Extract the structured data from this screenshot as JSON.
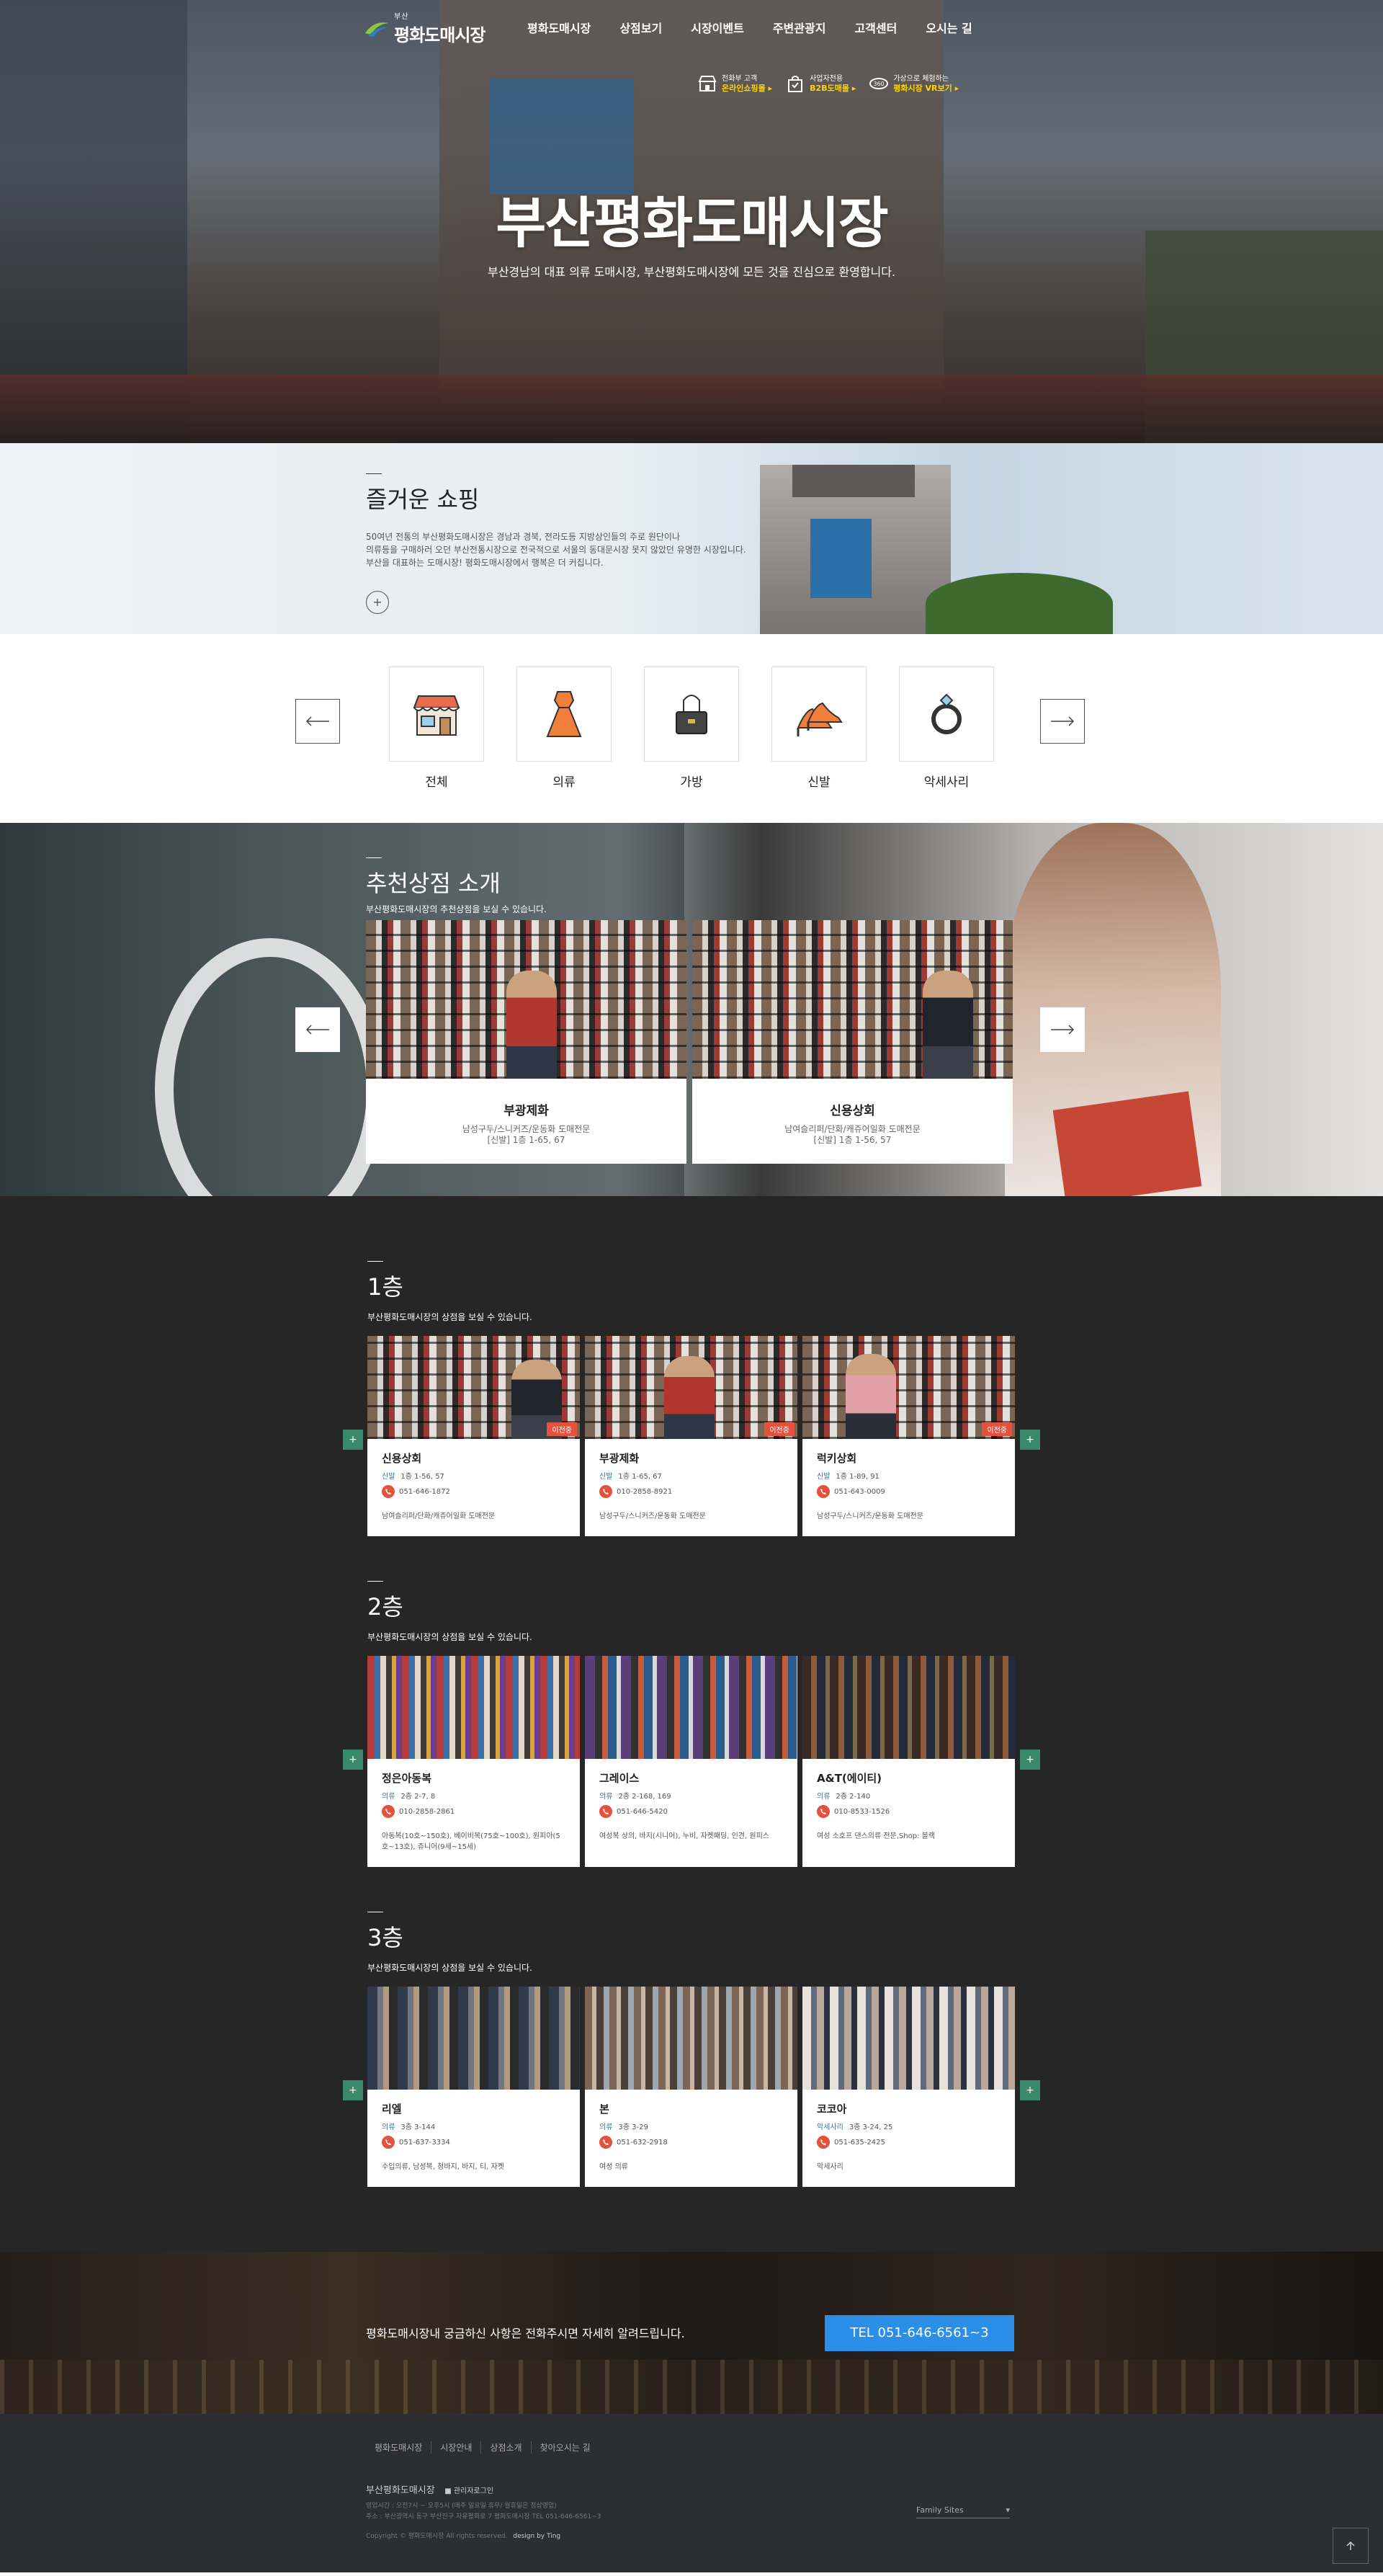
{
  "header": {
    "logo_small": "부산",
    "logo_main": "평화도매시장",
    "nav": [
      "평화도매시장",
      "상점보기",
      "시장이벤트",
      "주변관광지",
      "고객센터",
      "오시는 길"
    ],
    "quick": [
      {
        "line1": "전화부 고객",
        "line2": "온라인쇼핑몰 ▸",
        "icon": "shop-icon"
      },
      {
        "line1": "사업자전용",
        "line2": "B2B도매몰 ▸",
        "icon": "bag-icon"
      },
      {
        "line1": "가상으로 체험하는",
        "line2": "평화시장 VR보기 ▸",
        "icon": "vr-icon"
      }
    ]
  },
  "hero": {
    "title": "부산평화도매시장",
    "subtitle": "부산경남의 대표 의류 도매시장, 부산평화도매시장에 모든 것을 진심으로 환영합니다."
  },
  "shopping": {
    "title": "즐거운 쇼핑",
    "lines": [
      "50여년 전통의 부산평화도매시장은 경남과 경북, 전라도등 지방상인들의 주로 원단이나",
      "의류등을 구매하러 오던 부산전통시장으로 전국적으로 서울의 동대문시장 못지 않았던 유명한 시장입니다.",
      "부산을 대표하는 도매시장! 평화도매시장에서 행복은 더 커집니다."
    ],
    "more": "+"
  },
  "categories": {
    "items": [
      {
        "label": "전체",
        "icon": "store-icon"
      },
      {
        "label": "의류",
        "icon": "dress-icon"
      },
      {
        "label": "가방",
        "icon": "handbag-icon"
      },
      {
        "label": "신발",
        "icon": "heels-icon"
      },
      {
        "label": "악세사리",
        "icon": "ring-icon"
      }
    ]
  },
  "recommended": {
    "title": "추천상점 소개",
    "subtitle": "부산평화도매시장의 추천상점을 보실 수 있습니다.",
    "cards": [
      {
        "name": "부광제화",
        "desc1": "남성구두/스니커즈/운동화 도매전문",
        "desc2": "[신발] 1층 1-65, 67"
      },
      {
        "name": "신용상회",
        "desc1": "남여슬리퍼/단화/캐쥬어일화 도매전문",
        "desc2": "[신발] 1층 1-56, 57"
      }
    ]
  },
  "floors": [
    {
      "title": "1층",
      "subtitle": "부산평화도매시장의 상점을 보실 수 있습니다.",
      "cards": [
        {
          "name": "신용상회",
          "cat": "신발",
          "loc": "1층 1-56, 57",
          "tel": "051-646-1872",
          "note": "남여슬리퍼/단화/캐쥬어일화 도매전문",
          "badge": "이전중"
        },
        {
          "name": "부광제화",
          "cat": "신발",
          "loc": "1층 1-65, 67",
          "tel": "010-2858-8921",
          "note": "남성구두/스니커즈/운동화 도매전문",
          "badge": "이전중"
        },
        {
          "name": "럭키상회",
          "cat": "신발",
          "loc": "1층 1-89, 91",
          "tel": "051-643-0009",
          "note": "남성구두/스니커즈/운동화 도매전문",
          "badge": "이전중"
        }
      ]
    },
    {
      "title": "2층",
      "subtitle": "부산평화도매시장의 상점을 보실 수 있습니다.",
      "cards": [
        {
          "name": "정은아동복",
          "cat": "의류",
          "loc": "2층 2-7, 8",
          "tel": "010-2858-2861",
          "note": "아동복(10호~150호), 베이비복(75호~100호), 원피아(5호~13호), 쥬니어(9세~15세)",
          "badge": ""
        },
        {
          "name": "그레이스",
          "cat": "의류",
          "loc": "2층 2-168, 169",
          "tel": "051-646-5420",
          "note": "여성복 상의, 바지(시니어), 누비, 자켓패딩, 인견, 원피스",
          "badge": ""
        },
        {
          "name": "A&T(에이티)",
          "cat": "의류",
          "loc": "2층 2-140",
          "tel": "010-8533-1526",
          "note": "여성 소호프 댄스의류 전문,Shop: 블랙",
          "badge": ""
        }
      ]
    },
    {
      "title": "3층",
      "subtitle": "부산평화도매시장의 상점을 보실 수 있습니다.",
      "cards": [
        {
          "name": "리엘",
          "cat": "의류",
          "loc": "3층 3-144",
          "tel": "051-637-3334",
          "note": "수입의류, 남성복, 청바지, 바지, 티, 자켓",
          "badge": ""
        },
        {
          "name": "본",
          "cat": "의류",
          "loc": "3층 3-29",
          "tel": "051-632-2918",
          "note": "여성 의류",
          "badge": ""
        },
        {
          "name": "코코아",
          "cat": "악세사리",
          "loc": "3층 3-24, 25",
          "tel": "051-635-2425",
          "note": "악세사리",
          "badge": ""
        }
      ]
    }
  ],
  "cta": {
    "text": "평화도매시장내 궁금하신 사항은 전화주시면 자세히 알려드립니다.",
    "button": "TEL 051-646-6561~3"
  },
  "footer": {
    "nav": [
      "평화도매시장",
      "시장안내",
      "상점소개",
      "찾아오시는 길"
    ],
    "name": "부산평화도매시장",
    "admin": "■ 관리자로그인",
    "line1": "영업시간 : 오전7시 ~ 오후5시 (매주 일요일 휴무/ 월휴일은 정상영업)",
    "line2": "주소 : 부산광역시 동구 부산진구 자유평화로 7 평화도매시장   TEL 051-646-6561~3",
    "copyright": "Copyright © 평화도매시장 All rights reserved.",
    "design": "design by Ting",
    "family": "Family Sites",
    "colors": {
      "cta_button": "#2b8fe8",
      "badge": "#e4523d",
      "nav_side": "#3c8a6e"
    }
  }
}
